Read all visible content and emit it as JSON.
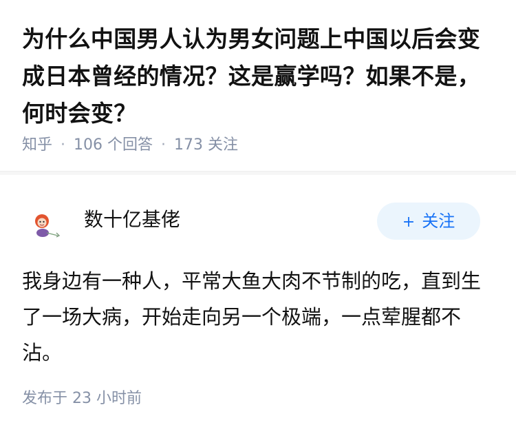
{
  "question": {
    "title": "为什么中国男人认为男女问题上中国以后会变成日本曾经的情况？这是赢学吗？如果不是，何时会变？",
    "source": "知乎",
    "answer_count": "106",
    "answer_unit": "个回答",
    "follow_count": "173",
    "follow_unit": "关注",
    "separator": "·"
  },
  "answer": {
    "author_name": "数十亿基佬",
    "avatar_icon": "cartoon-avatar",
    "follow_button": {
      "icon": "+",
      "label": "关注"
    },
    "content": "我身边有一种人，平常大鱼大肉不节制的吃，直到生了一场大病，开始走向另一个极端，一点荤腥都不沾。",
    "publish_label": "发布于",
    "publish_time": "23 小时前"
  },
  "colors": {
    "title": "#121212",
    "meta": "#8590a6",
    "follow_bg": "#ebf5fd",
    "follow_text": "#1772f6",
    "divider": "#f6f6f6"
  }
}
